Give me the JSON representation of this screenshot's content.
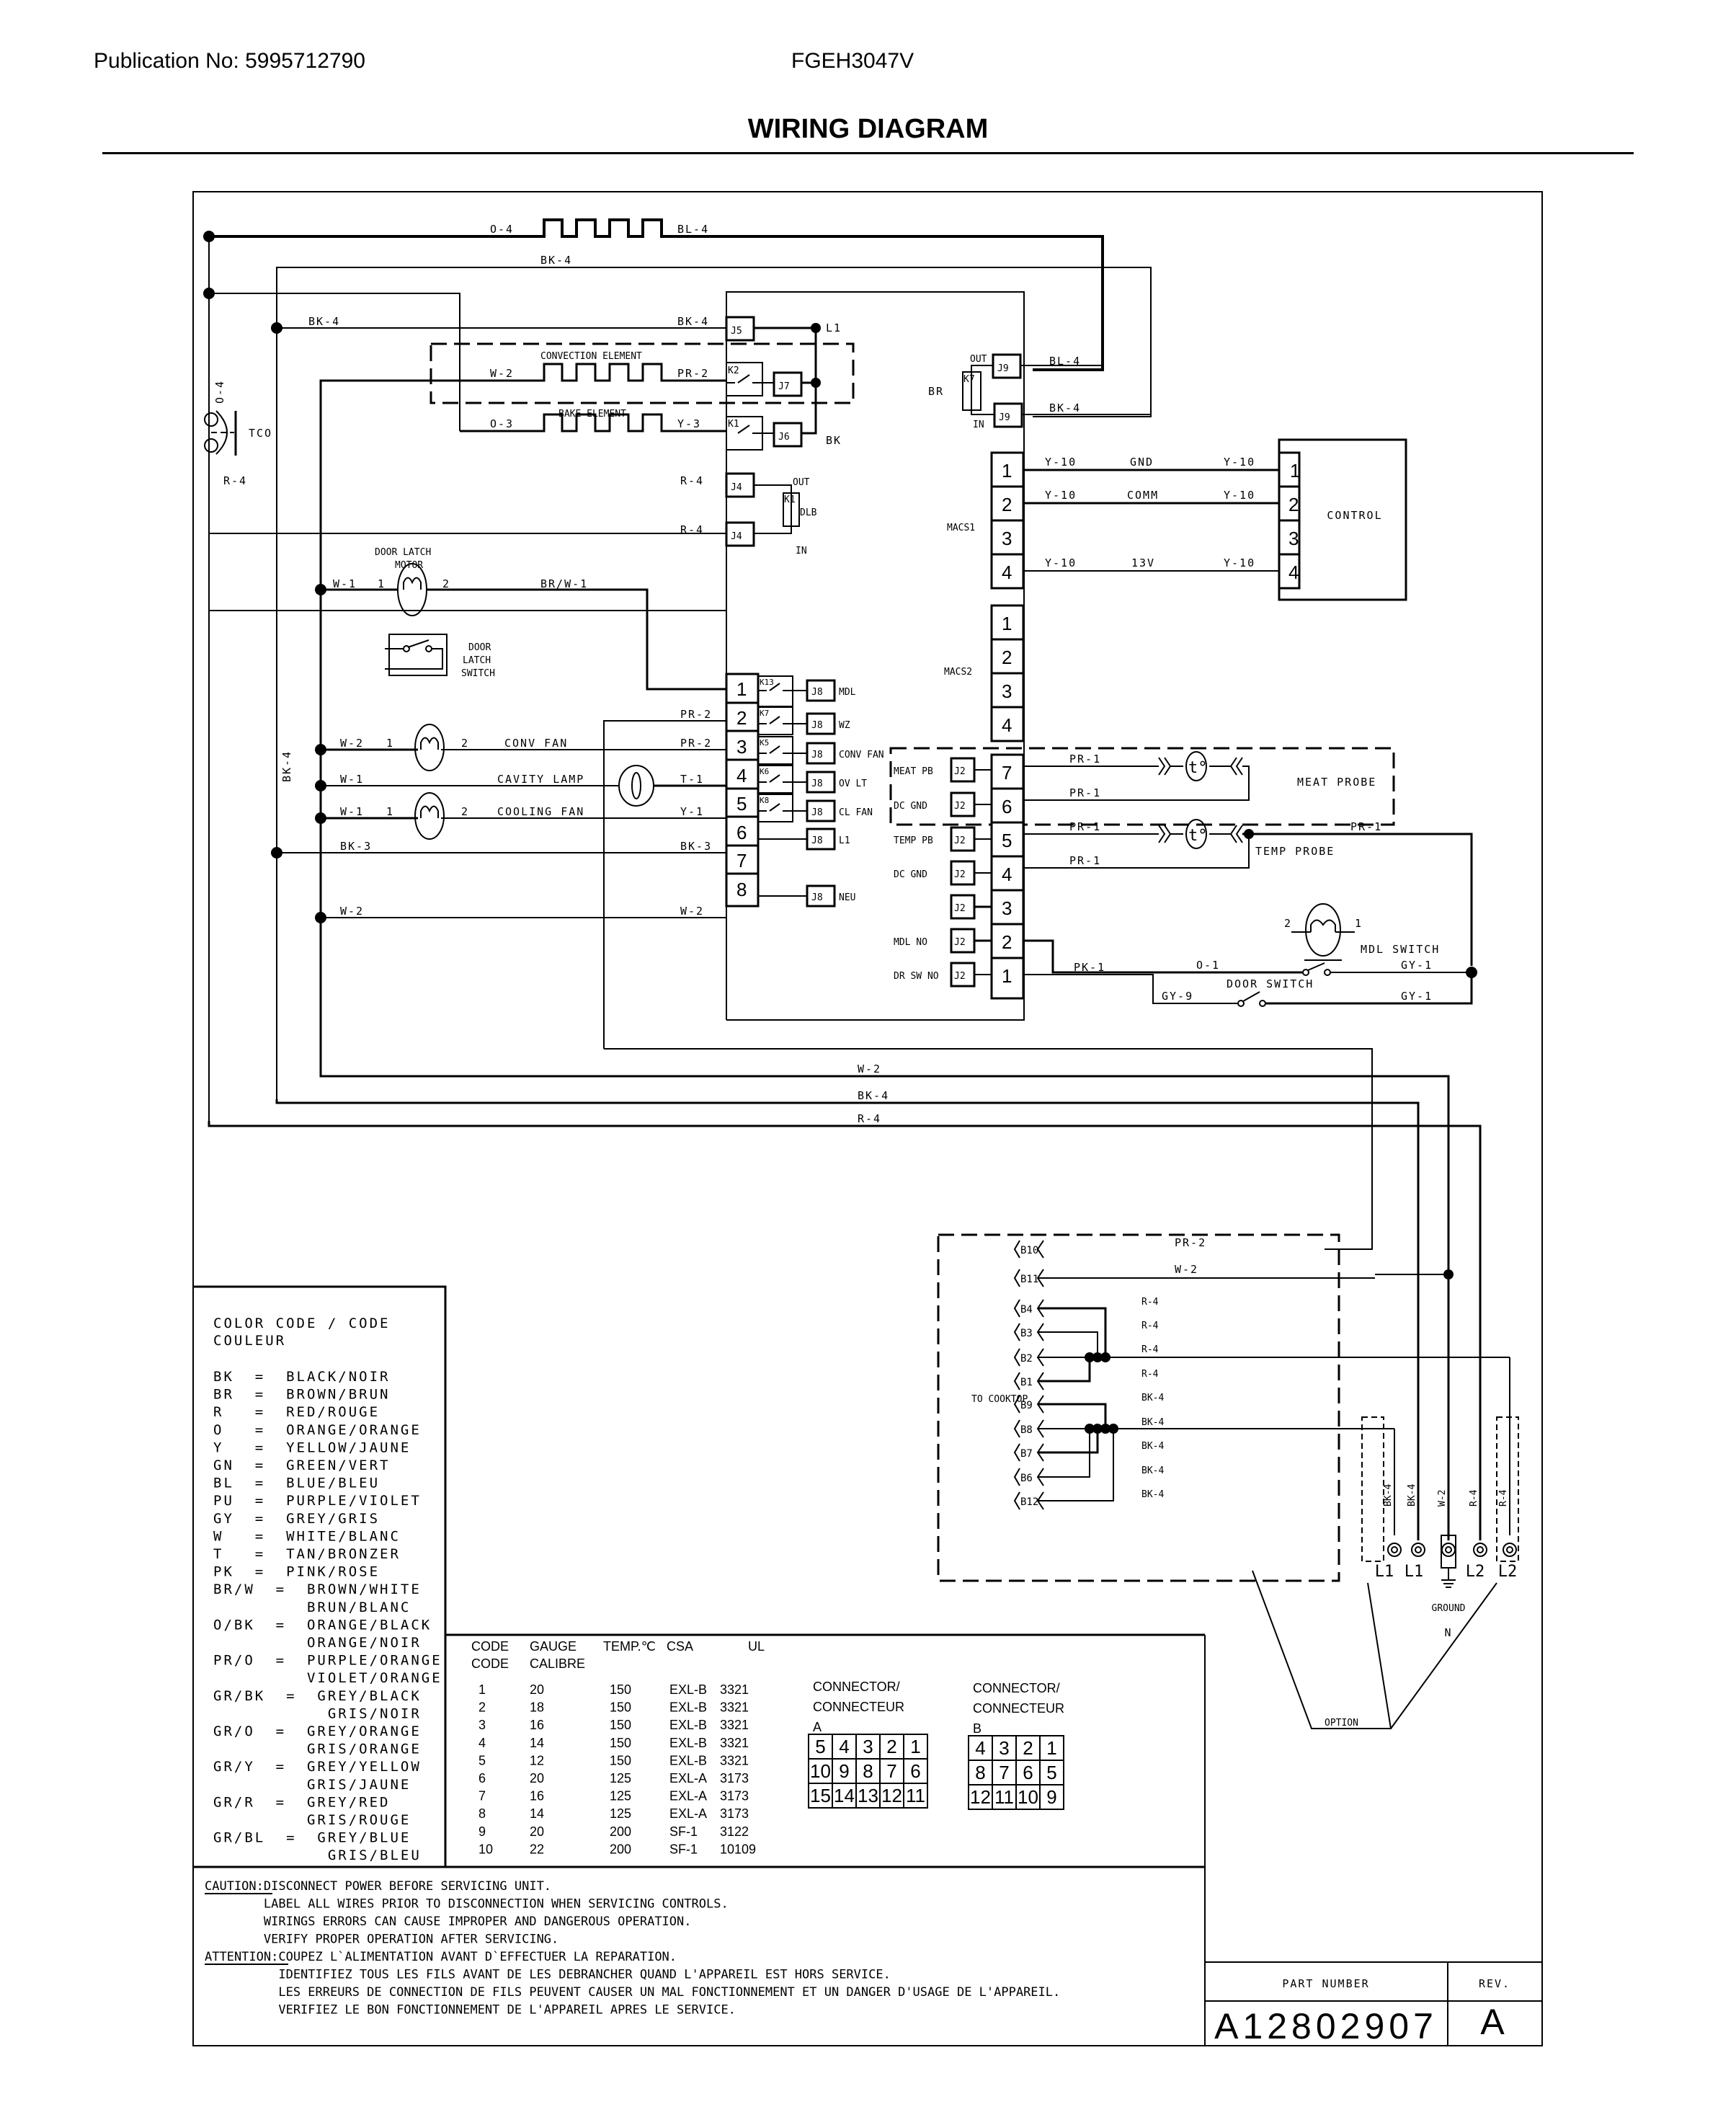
{
  "header": {
    "publication": "Publication No: 5995712790",
    "model": "FGEH3047V",
    "title": "WIRING DIAGRAM"
  },
  "wires": {
    "broil_in": "O-4",
    "broil_out": "BL-4",
    "bk4_top": "BK-4",
    "bk4_j5_left": "BK-4",
    "bk4_j5_right": "BK-4",
    "conv_w": "W-2",
    "conv_pr": "PR-2",
    "bake_o": "O-3",
    "bake_y": "Y-3",
    "r4_top_left": "R-4",
    "r4_j4_upper": "R-4",
    "r4_j4_lower": "R-4",
    "tco_wire": "O-4",
    "j9_bl": "BL-4",
    "j9_bk": "BK-4",
    "macs_y10": "Y-10",
    "dlm_w": "W-1",
    "dlm_brw": "BR/W-1",
    "pr2_2": "PR-2",
    "convfan_w": "W-2",
    "convfan_pr": "PR-2",
    "lamp_w": "W-1",
    "lamp_t": "T-1",
    "cool_w": "W-1",
    "cool_y": "Y-1",
    "bk3_left": "BK-3",
    "bk3_right": "BK-3",
    "w2_left": "W-2",
    "w2_right": "W-2",
    "bk4_vertical": "BK-4",
    "pr1": "PR-1",
    "pk1": "PK-1",
    "o1": "O-1",
    "gy1": "GY-1",
    "gy9": "GY-9",
    "long_w2": "W-2",
    "long_bk4": "BK-4",
    "long_r4": "R-4",
    "b10": "PR-2",
    "b11": "W-2",
    "r4": "R-4",
    "bk4": "BK-4",
    "term_bk4a": "BK-4",
    "term_bk4b": "BK-4",
    "term_w2": "W-2",
    "term_r4a": "R-4",
    "term_r4b": "R-4"
  },
  "components": {
    "tco": "TCO",
    "convection_element": "CONVECTION ELEMENT",
    "bake_element": "BAKE ELEMENT",
    "l1": "L1",
    "bk": "BK",
    "out": "OUT",
    "in": "IN",
    "dlb": "DLB",
    "br": "BR",
    "control": "CONTROL",
    "macs1": "MACS1",
    "macs2": "MACS2",
    "gnd": "GND",
    "comm": "COMM",
    "v13": "13V",
    "door_latch_motor": [
      "DOOR LATCH",
      "MOTOR"
    ],
    "door_latch_switch": [
      "DOOR",
      "LATCH",
      "SWITCH"
    ],
    "conv_fan": "CONV FAN",
    "cavity_lamp": "CAVITY LAMP",
    "cooling_fan": "COOLING FAN",
    "meat_probe": "MEAT PROBE",
    "temp_probe": "TEMP PROBE",
    "mdl_switch": "MDL SWITCH",
    "door_switch": "DOOR SWITCH",
    "to_cooktop": "TO COOKTOP",
    "ground": "GROUND",
    "n": "N",
    "option": "OPTION",
    "probe_symbol": "t°"
  },
  "connectors": {
    "j5": "J5",
    "j7": "J7",
    "j6": "J6",
    "j4": "J4",
    "j9": "J9",
    "j8": "J8",
    "j2": "J2",
    "relays": [
      "K13",
      "K7",
      "K5",
      "K6",
      "K8"
    ],
    "k2": "K2",
    "k1": "K1",
    "k7": "K7",
    "j8_labels": [
      "MDL",
      "WZ",
      "CONV FAN",
      "OV LT",
      "CL FAN",
      "L1",
      "",
      "NEU"
    ],
    "j2_labels": [
      "MEAT PB",
      "DC GND",
      "TEMP PB",
      "DC GND",
      "",
      "MDL NO",
      "DR SW NO"
    ],
    "j2_pins": [
      "7",
      "6",
      "5",
      "4",
      "3",
      "2",
      "1"
    ],
    "main_pins": [
      "1",
      "2",
      "3",
      "4",
      "5",
      "6",
      "7",
      "8"
    ],
    "macs_pins": [
      "1",
      "2",
      "3",
      "4"
    ],
    "b_labels": [
      "B10",
      "B11",
      "B4",
      "B3",
      "B2",
      "B1",
      "B9",
      "B8",
      "B7",
      "B6",
      "B12"
    ],
    "terminals": [
      "L1",
      "L1",
      "L2",
      "L2"
    ],
    "motor_pins": [
      "1",
      "2"
    ]
  },
  "color_code": {
    "title": [
      "COLOR CODE / CODE",
      "COULEUR"
    ],
    "entries": [
      "BK  =  BLACK/NOIR",
      "BR  =  BROWN/BRUN",
      "R   =  RED/ROUGE",
      "O   =  ORANGE/ORANGE",
      "Y   =  YELLOW/JAUNE",
      "GN  =  GREEN/VERT",
      "BL  =  BLUE/BLEU",
      "PU  =  PURPLE/VIOLET",
      "GY  =  GREY/GRIS",
      "W   =  WHITE/BLANC",
      "T   =  TAN/BRONZER",
      "PK  =  PINK/ROSE",
      "BR/W  =  BROWN/WHITE",
      "         BRUN/BLANC",
      "O/BK  =  ORANGE/BLACK",
      "         ORANGE/NOIR",
      "PR/O  =  PURPLE/ORANGE",
      "         VIOLET/ORANGE",
      "GR/BK  =  GREY/BLACK",
      "           GRIS/NOIR",
      "GR/O  =  GREY/ORANGE",
      "         GRIS/ORANGE",
      "GR/Y  =  GREY/YELLOW",
      "         GRIS/JAUNE",
      "GR/R  =  GREY/RED",
      "         GRIS/ROUGE",
      "GR/BL  =  GREY/BLUE",
      "           GRIS/BLEU"
    ]
  },
  "gauge_table": {
    "headers": [
      "CODE",
      "GAUGE",
      "TEMP.℃",
      "CSA",
      "UL"
    ],
    "headers2": [
      "CODE",
      "CALIBRE",
      "",
      "",
      ""
    ],
    "rows": [
      [
        "1",
        "20",
        "150",
        "EXL-B",
        "3321"
      ],
      [
        "2",
        "18",
        "150",
        "EXL-B",
        "3321"
      ],
      [
        "3",
        "16",
        "150",
        "EXL-B",
        "3321"
      ],
      [
        "4",
        "14",
        "150",
        "EXL-B",
        "3321"
      ],
      [
        "5",
        "12",
        "150",
        "EXL-B",
        "3321"
      ],
      [
        "6",
        "20",
        "125",
        "EXL-A",
        "3173"
      ],
      [
        "7",
        "16",
        "125",
        "EXL-A",
        "3173"
      ],
      [
        "8",
        "14",
        "125",
        "EXL-A",
        "3173"
      ],
      [
        "9",
        "20",
        "200",
        "SF-1",
        "3122"
      ],
      [
        "10",
        "22",
        "200",
        "SF-1",
        "10109"
      ]
    ]
  },
  "connector_a": {
    "title": [
      "CONNECTOR/",
      "CONNECTEUR",
      "A"
    ],
    "grid": [
      [
        "5",
        "4",
        "3",
        "2",
        "1"
      ],
      [
        "10",
        "9",
        "8",
        "7",
        "6"
      ],
      [
        "15",
        "14",
        "13",
        "12",
        "11"
      ]
    ]
  },
  "connector_b": {
    "title": [
      "CONNECTOR/",
      "CONNECTEUR",
      "B"
    ],
    "grid": [
      [
        "4",
        "3",
        "2",
        "1"
      ],
      [
        "8",
        "7",
        "6",
        "5"
      ],
      [
        "12",
        "11",
        "10",
        "9"
      ]
    ]
  },
  "caution": {
    "lines": [
      "CAUTION:DISCONNECT POWER BEFORE SERVICING UNIT.",
      "        LABEL ALL WIRES PRIOR TO DISCONNECTION WHEN SERVICING CONTROLS.",
      "        WIRINGS ERRORS CAN CAUSE IMPROPER AND DANGEROUS OPERATION.",
      "        VERIFY PROPER OPERATION AFTER SERVICING.",
      "ATTENTION:COUPEZ L`ALIMENTATION AVANT D`EFFECTUER LA REPARATION.",
      "          IDENTIFIEZ TOUS LES FILS AVANT DE LES DEBRANCHER QUAND L'APPAREIL EST HORS SERVICE.",
      "          LES ERREURS DE CONNECTION DE FILS PEUVENT CAUSER UN MAL FONCTIONNEMENT ET UN DANGER D'USAGE DE L'APPAREIL.",
      "          VERIFIEZ LE BON FONCTIONNEMENT DE L'APPAREIL APRES LE SERVICE."
    ]
  },
  "title_block": {
    "part_number_label": "PART NUMBER",
    "rev_label": "REV.",
    "part_number": "A12802907",
    "rev": "A"
  }
}
